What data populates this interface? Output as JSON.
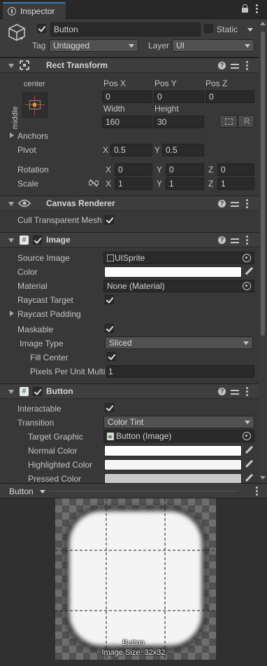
{
  "tab": {
    "title": "Inspector"
  },
  "header": {
    "object_name": "Button",
    "static_label": "Static",
    "tag_label": "Tag",
    "tag_value": "Untagged",
    "layer_label": "Layer",
    "layer_value": "UI"
  },
  "rect_transform": {
    "title": "Rect Transform",
    "anchor_h": "center",
    "anchor_v": "middle",
    "pos_x_label": "Pos X",
    "pos_y_label": "Pos Y",
    "pos_z_label": "Pos Z",
    "pos_x": "0",
    "pos_y": "0",
    "pos_z": "0",
    "width_label": "Width",
    "height_label": "Height",
    "width": "160",
    "height": "30",
    "r_button": "R",
    "anchors_label": "Anchors",
    "pivot_label": "Pivot",
    "pivot_x_label": "X",
    "pivot_x": "0.5",
    "pivot_y_label": "Y",
    "pivot_y": "0.5",
    "rotation_label": "Rotation",
    "rot_x": "0",
    "rot_y": "0",
    "rot_z": "0",
    "scale_label": "Scale",
    "scale_x": "1",
    "scale_y": "1",
    "scale_z": "1",
    "x_label": "X",
    "y_label": "Y",
    "z_label": "Z"
  },
  "canvas_renderer": {
    "title": "Canvas Renderer",
    "cull_label": "Cull Transparent Mesh"
  },
  "image": {
    "title": "Image",
    "source_image_label": "Source Image",
    "source_image_value": "UISprite",
    "color_label": "Color",
    "color_value": "#ffffff",
    "material_label": "Material",
    "material_value": "None (Material)",
    "raycast_target_label": "Raycast Target",
    "raycast_padding_label": "Raycast Padding",
    "maskable_label": "Maskable",
    "image_type_label": "Image Type",
    "image_type_value": "Sliced",
    "fill_center_label": "Fill Center",
    "ppu_label": "Pixels Per Unit Multiplier",
    "ppu_value": "1"
  },
  "button": {
    "title": "Button",
    "interactable_label": "Interactable",
    "transition_label": "Transition",
    "transition_value": "Color Tint",
    "target_graphic_label": "Target Graphic",
    "target_graphic_value": "Button (Image)",
    "normal_color_label": "Normal Color",
    "normal_color_value": "#ffffff",
    "highlighted_color_label": "Highlighted Color",
    "highlighted_color_value": "#f5f5f5",
    "pressed_color_label": "Pressed Color",
    "pressed_color_value": "#c8c8c8"
  },
  "preview": {
    "dropdown_label": "Button",
    "caption_name": "Button",
    "caption_size": "Image Size: 32x32"
  },
  "colors": {
    "panel_bg": "#383838",
    "header_bg": "#3e3e3e",
    "field_bg": "#2a2a2a",
    "accent_orange": "#e89a1e"
  }
}
